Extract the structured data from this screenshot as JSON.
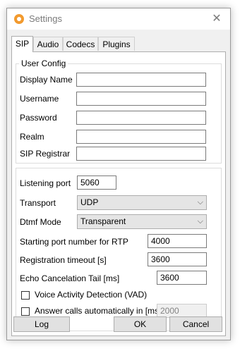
{
  "window": {
    "title": "Settings",
    "close_glyph": "✕"
  },
  "tabs": [
    {
      "label": "SIP",
      "active": true
    },
    {
      "label": "Audio"
    },
    {
      "label": "Codecs"
    },
    {
      "label": "Plugins"
    }
  ],
  "user_config": {
    "legend": "User Config",
    "display_name": {
      "label": "Display Name",
      "value": ""
    },
    "username": {
      "label": "Username",
      "value": ""
    },
    "password": {
      "label": "Password",
      "value": ""
    },
    "realm": {
      "label": "Realm",
      "value": ""
    },
    "sip_registrar": {
      "label": "SIP Registrar",
      "value": ""
    }
  },
  "network": {
    "listening_port": {
      "label": "Listening port",
      "value": "5060"
    },
    "transport": {
      "label": "Transport",
      "value": "UDP"
    },
    "dtmf_mode": {
      "label": "Dtmf Mode",
      "value": "Transparent"
    },
    "rtp_port": {
      "label": "Starting port number for RTP",
      "value": "4000"
    },
    "reg_timeout": {
      "label": "Registration timeout [s]",
      "value": "3600"
    },
    "echo_tail": {
      "label": "Echo Cancelation Tail [ms]",
      "value": "3600"
    },
    "vad": {
      "label": "Voice Activity Detection (VAD)",
      "checked": false
    },
    "auto_answer": {
      "label": "Answer calls automatically in [ms]",
      "checked": false,
      "value": "2000"
    }
  },
  "buttons": {
    "log": "Log",
    "ok": "OK",
    "cancel": "Cancel"
  },
  "icons": {
    "app": "settings-app-icon",
    "chevron": "chevron-down-icon",
    "close": "close-icon"
  },
  "colors": {
    "app_icon": "#f29a2e",
    "panel": "#ffffff",
    "chrome": "#f0f0f0"
  }
}
